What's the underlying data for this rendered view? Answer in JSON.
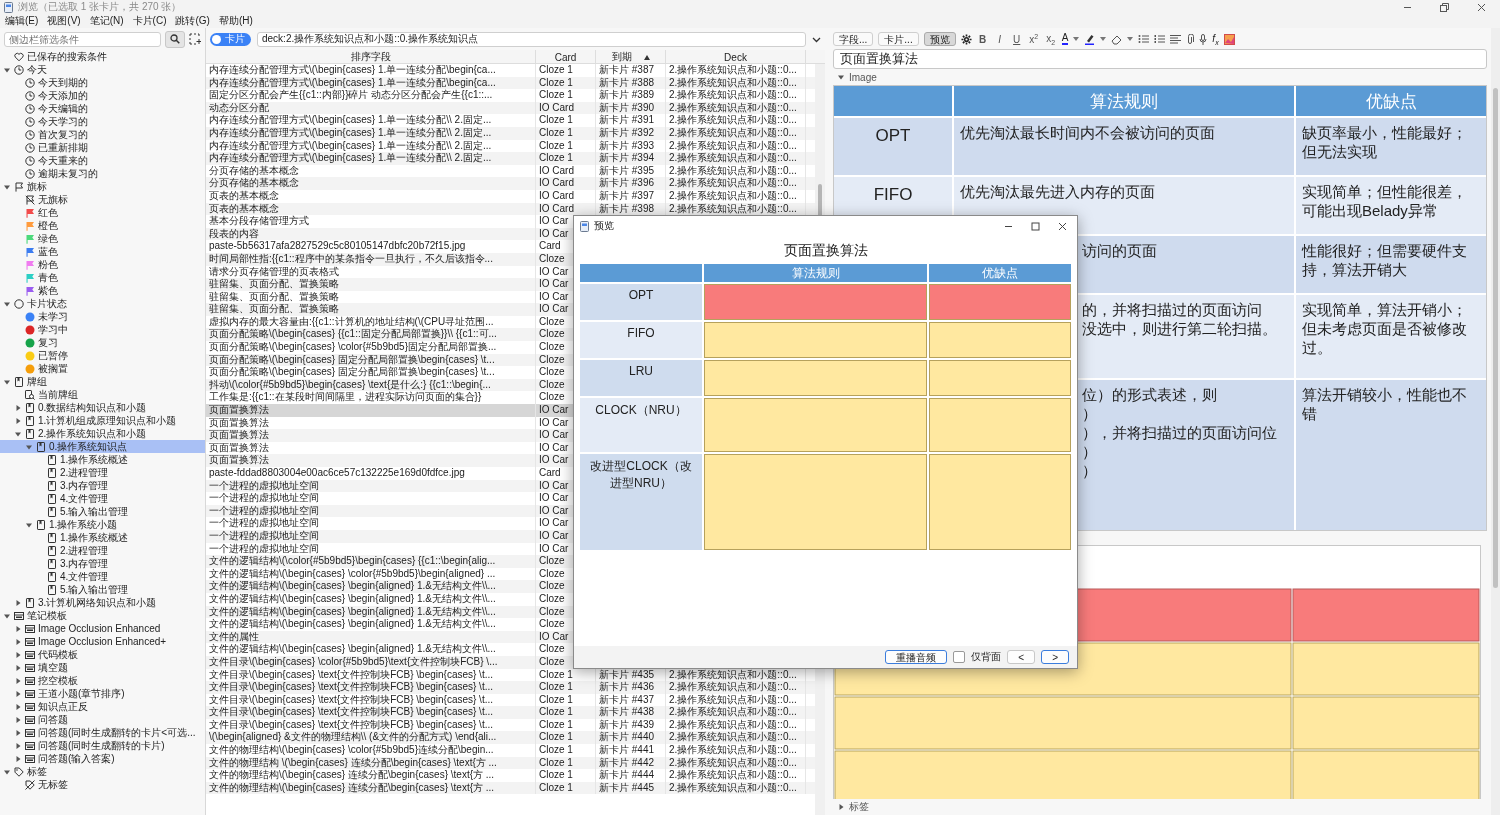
{
  "window": {
    "title": "浏览（已选取 1 张卡片，共 270 张）"
  },
  "menu": [
    "编辑(E)",
    "视图(V)",
    "笔记(N)",
    "卡片(C)",
    "跳转(G)",
    "帮助(H)"
  ],
  "sidebar": {
    "search": {
      "placeholder": "侧边栏筛选条件"
    },
    "tree": [
      {
        "label": "已保存的搜索条件",
        "kind": "saved",
        "selected": false
      },
      {
        "label": "今天",
        "kind": "clock",
        "expanded": true,
        "selected": false,
        "children": [
          {
            "label": "今天到期的",
            "kind": "clock",
            "selected": false
          },
          {
            "label": "今天添加的",
            "kind": "clock",
            "selected": false
          },
          {
            "label": "今天编辑的",
            "kind": "clock",
            "selected": false
          },
          {
            "label": "今天学习的",
            "kind": "clock",
            "selected": false
          },
          {
            "label": "首次复习的",
            "kind": "clock",
            "selected": false
          },
          {
            "label": "已重新排期",
            "kind": "clock",
            "selected": false
          },
          {
            "label": "今天重来的",
            "kind": "clock",
            "selected": false
          },
          {
            "label": "逾期未复习的",
            "kind": "clock",
            "selected": false
          }
        ]
      },
      {
        "label": "旗标",
        "kind": "flag",
        "expanded": true,
        "selected": false,
        "children": [
          {
            "label": "无旗标",
            "kind": "flag-off",
            "selected": false
          },
          {
            "label": "红色",
            "kind": "colored-flag",
            "color": "#f24b4b",
            "selected": false
          },
          {
            "label": "橙色",
            "kind": "colored-flag",
            "color": "#ff9b3d",
            "selected": false
          },
          {
            "label": "绿色",
            "kind": "colored-flag",
            "color": "#4cd97b",
            "selected": false
          },
          {
            "label": "蓝色",
            "kind": "colored-flag",
            "color": "#3b7cf0",
            "selected": false
          },
          {
            "label": "粉色",
            "kind": "colored-flag",
            "color": "#f07cf0",
            "selected": false
          },
          {
            "label": "青色",
            "kind": "colored-flag",
            "color": "#2ccfc4",
            "selected": false
          },
          {
            "label": "紫色",
            "kind": "colored-flag",
            "color": "#9a5cf0",
            "selected": false
          }
        ]
      },
      {
        "label": "卡片状态",
        "kind": "status",
        "expanded": true,
        "selected": false,
        "children": [
          {
            "label": "未学习",
            "kind": "status-dot",
            "color": "#3b82f6",
            "selected": false
          },
          {
            "label": "学习中",
            "kind": "status-dot",
            "color": "#dc2626",
            "selected": false
          },
          {
            "label": "复习",
            "kind": "status-dot",
            "color": "#16a34a",
            "selected": false
          },
          {
            "label": "已暂停",
            "kind": "status-dot",
            "color": "#facc15",
            "selected": false
          },
          {
            "label": "被搁置",
            "kind": "status-dot",
            "color": "#f59e0b",
            "selected": false
          }
        ]
      },
      {
        "label": "牌组",
        "kind": "deck",
        "expanded": true,
        "selected": false,
        "children": [
          {
            "label": "当前牌组",
            "kind": "current-deck",
            "selected": false
          },
          {
            "label": "0.数据结构知识点和小题",
            "kind": "deck",
            "expanded": false,
            "selected": false
          },
          {
            "label": "1.计算机组成原理知识点和小题",
            "kind": "deck",
            "expanded": false,
            "selected": false
          },
          {
            "label": "2.操作系统知识点和小题",
            "kind": "deck",
            "expanded": true,
            "selected": false,
            "children": [
              {
                "label": "0.操作系统知识点",
                "kind": "deck",
                "expanded": true,
                "selected": true,
                "children": [
                  {
                    "label": "1.操作系统概述",
                    "kind": "deck",
                    "selected": false
                  },
                  {
                    "label": "2.进程管理",
                    "kind": "deck",
                    "selected": false
                  },
                  {
                    "label": "3.内存管理",
                    "kind": "deck",
                    "selected": false
                  },
                  {
                    "label": "4.文件管理",
                    "kind": "deck",
                    "selected": false
                  },
                  {
                    "label": "5.输入输出管理",
                    "kind": "deck",
                    "selected": false
                  }
                ]
              },
              {
                "label": "1.操作系统小题",
                "kind": "deck",
                "expanded": true,
                "selected": false,
                "children": [
                  {
                    "label": "1.操作系统概述",
                    "kind": "deck",
                    "selected": false
                  },
                  {
                    "label": "2.进程管理",
                    "kind": "deck",
                    "selected": false
                  },
                  {
                    "label": "3.内存管理",
                    "kind": "deck",
                    "selected": false
                  },
                  {
                    "label": "4.文件管理",
                    "kind": "deck",
                    "selected": false
                  },
                  {
                    "label": "5.输入输出管理",
                    "kind": "deck",
                    "selected": false
                  }
                ]
              }
            ]
          },
          {
            "label": "3.计算机网络知识点和小题",
            "kind": "deck",
            "expanded": false,
            "selected": false
          }
        ]
      },
      {
        "label": "笔记模板",
        "kind": "notetype",
        "expanded": true,
        "selected": false,
        "children": [
          {
            "label": "Image Occlusion Enhanced",
            "kind": "notetype",
            "expanded": false,
            "selected": false
          },
          {
            "label": "Image Occlusion Enhanced+",
            "kind": "notetype",
            "expanded": false,
            "selected": false
          },
          {
            "label": "代码模板",
            "kind": "notetype",
            "expanded": false,
            "selected": false
          },
          {
            "label": "填空题",
            "kind": "notetype",
            "expanded": false,
            "selected": false
          },
          {
            "label": "挖空模板",
            "kind": "notetype",
            "expanded": false,
            "selected": false
          },
          {
            "label": "王道小题(章节排序)",
            "kind": "notetype",
            "expanded": false,
            "selected": false
          },
          {
            "label": "知识点正反",
            "kind": "notetype",
            "expanded": false,
            "selected": false
          },
          {
            "label": "问答题",
            "kind": "notetype",
            "expanded": false,
            "selected": false
          },
          {
            "label": "问答题(同时生成翻转的卡片<可选...",
            "kind": "notetype",
            "expanded": false,
            "selected": false
          },
          {
            "label": "问答题(同时生成翻转的卡片)",
            "kind": "notetype",
            "expanded": false,
            "selected": false
          },
          {
            "label": "问答题(输入答案)",
            "kind": "notetype",
            "expanded": false,
            "selected": false
          }
        ]
      },
      {
        "label": "标签",
        "kind": "tag",
        "expanded": true,
        "selected": false,
        "children": [
          {
            "label": "无标签",
            "kind": "tag-off",
            "selected": false
          }
        ]
      }
    ]
  },
  "table": {
    "toggle": {
      "label": "卡片",
      "on": true
    },
    "search": {
      "value": "deck:2.操作系统知识点和小题::0.操作系统知识点"
    },
    "columns": [
      {
        "label": "排序字段",
        "sorted": false
      },
      {
        "label": "Card",
        "sorted": false
      },
      {
        "label": "到期",
        "sorted": true
      },
      {
        "label": "Deck",
        "sorted": false
      }
    ],
    "rows": [
      {
        "sort_field": "内存连续分配管理方式\\(\\begin{cases} 1.单一连续分配\\begin{ca...",
        "card": "Cloze 1",
        "due": "新卡片 #387",
        "deck": "2.操作系统知识点和小题::0...",
        "selected": false
      },
      {
        "sort_field": "内存连续分配管理方式\\(\\begin{cases} 1.单一连续分配\\begin{ca...",
        "card": "Cloze 1",
        "due": "新卡片 #388",
        "deck": "2.操作系统知识点和小题::0...",
        "selected": false
      },
      {
        "sort_field": "固定分区分配会产生{{c1::内部}}碎片 动态分区分配会产生{{c1::...",
        "card": "Cloze 1",
        "due": "新卡片 #389",
        "deck": "2.操作系统知识点和小题::0...",
        "selected": false
      },
      {
        "sort_field": "动态分区分配",
        "card": "IO Card",
        "due": "新卡片 #390",
        "deck": "2.操作系统知识点和小题::0...",
        "selected": false
      },
      {
        "sort_field": "内存连续分配管理方式\\(\\begin{cases} 1.单一连续分配\\\\ 2.固定...",
        "card": "Cloze 1",
        "due": "新卡片 #391",
        "deck": "2.操作系统知识点和小题::0...",
        "selected": false
      },
      {
        "sort_field": "内存连续分配管理方式\\(\\begin{cases} 1.单一连续分配\\\\ 2.固定...",
        "card": "Cloze 1",
        "due": "新卡片 #392",
        "deck": "2.操作系统知识点和小题::0...",
        "selected": false
      },
      {
        "sort_field": "内存连续分配管理方式\\(\\begin{cases} 1.单一连续分配\\\\ 2.固定...",
        "card": "Cloze 1",
        "due": "新卡片 #393",
        "deck": "2.操作系统知识点和小题::0...",
        "selected": false
      },
      {
        "sort_field": "内存连续分配管理方式\\(\\begin{cases} 1.单一连续分配\\\\ 2.固定...",
        "card": "Cloze 1",
        "due": "新卡片 #394",
        "deck": "2.操作系统知识点和小题::0...",
        "selected": false
      },
      {
        "sort_field": "分页存储的基本概念",
        "card": "IO Card",
        "due": "新卡片 #395",
        "deck": "2.操作系统知识点和小题::0...",
        "selected": false
      },
      {
        "sort_field": "分页存储的基本概念",
        "card": "IO Card",
        "due": "新卡片 #396",
        "deck": "2.操作系统知识点和小题::0...",
        "selected": false
      },
      {
        "sort_field": "页表的基本概念",
        "card": "IO Card",
        "due": "新卡片 #397",
        "deck": "2.操作系统知识点和小题::0...",
        "selected": false
      },
      {
        "sort_field": "页表的基本概念",
        "card": "IO Card",
        "due": "新卡片 #398",
        "deck": "2.操作系统知识点和小题::0...",
        "selected": false
      },
      {
        "sort_field": "基本分段存储管理方式",
        "card": "IO Car",
        "selected": false
      },
      {
        "sort_field": "段表的内容",
        "card": "IO Car",
        "selected": false
      },
      {
        "sort_field": "paste-5b56317afa2827529c5c80105147dbfc20b72f15.jpg",
        "card": "Card",
        "selected": false
      },
      {
        "sort_field": "时间局部性指:{{c1::程序中的某条指令一旦执行，不久后该指令...",
        "card": "Cloze",
        "selected": false
      },
      {
        "sort_field": "请求分页存储管理的页表格式",
        "card": "IO Car",
        "selected": false
      },
      {
        "sort_field": "驻留集、页面分配、置换策略",
        "card": "IO Car",
        "selected": false
      },
      {
        "sort_field": "驻留集、页面分配、置换策略",
        "card": "IO Car",
        "selected": false
      },
      {
        "sort_field": "驻留集、页面分配、置换策略",
        "card": "IO Car",
        "selected": false
      },
      {
        "sort_field": "虚拟内存的最大容量由:{{c1::计算机的地址结构(\\(CPU寻址范围...",
        "card": "Cloze",
        "selected": false
      },
      {
        "sort_field": "页面分配策略\\(\\begin{cases} {{c1::固定分配局部置换}}\\\\ {{c1::可...",
        "card": "Cloze",
        "selected": false
      },
      {
        "sort_field": "页面分配策略\\(\\begin{cases} \\color{#5b9bd5}固定分配局部置换...",
        "card": "Cloze",
        "selected": false
      },
      {
        "sort_field": "页面分配策略\\(\\begin{cases} 固定分配局部置换\\begin{cases} \\t...",
        "card": "Cloze",
        "selected": false
      },
      {
        "sort_field": "页面分配策略\\(\\begin{cases} 固定分配局部置换\\begin{cases} \\t...",
        "card": "Cloze",
        "selected": false
      },
      {
        "sort_field": "抖动\\(\\color{#5b9bd5}\\begin{cases} \\text{是什么:} {{c1::\\begin{...",
        "card": "Cloze",
        "selected": false
      },
      {
        "sort_field": "工作集是:{{c1::在某段时间间隔里，进程实际访问页面的集合}}",
        "card": "Cloze",
        "selected": false
      },
      {
        "sort_field": "页面置换算法",
        "card": "IO Car",
        "selected": true
      },
      {
        "sort_field": "页面置换算法",
        "card": "IO Car",
        "selected": false
      },
      {
        "sort_field": "页面置换算法",
        "card": "IO Car",
        "selected": false
      },
      {
        "sort_field": "页面置换算法",
        "card": "IO Car",
        "selected": false
      },
      {
        "sort_field": "页面置换算法",
        "card": "IO Car",
        "selected": false
      },
      {
        "sort_field": "paste-fddad8803004e00ac6ce57c132225e169d0fdfce.jpg",
        "card": "Card",
        "selected": false
      },
      {
        "sort_field": "一个进程的虚拟地址空间",
        "card": "IO Car",
        "selected": false
      },
      {
        "sort_field": "一个进程的虚拟地址空间",
        "card": "IO Car",
        "selected": false
      },
      {
        "sort_field": "一个进程的虚拟地址空间",
        "card": "IO Car",
        "selected": false
      },
      {
        "sort_field": "一个进程的虚拟地址空间",
        "card": "IO Car",
        "selected": false
      },
      {
        "sort_field": "一个进程的虚拟地址空间",
        "card": "IO Car",
        "selected": false
      },
      {
        "sort_field": "一个进程的虚拟地址空间",
        "card": "IO Car",
        "selected": false
      },
      {
        "sort_field": "文件的逻辑结构\\(\\color{#5b9bd5}\\begin{cases} {{c1::\\begin{alig...",
        "card": "Cloze",
        "selected": false
      },
      {
        "sort_field": "文件的逻辑结构\\(\\begin{cases} \\color{#5b9bd5}\\begin{aligned} ...",
        "card": "Cloze",
        "selected": false
      },
      {
        "sort_field": "文件的逻辑结构\\(\\begin{cases} \\begin{aligned} 1.&无结构文件\\\\...",
        "card": "Cloze",
        "selected": false
      },
      {
        "sort_field": "文件的逻辑结构\\(\\begin{cases} \\begin{aligned} 1.&无结构文件\\\\...",
        "card": "Cloze",
        "selected": false
      },
      {
        "sort_field": "文件的逻辑结构\\(\\begin{cases} \\begin{aligned} 1.&无结构文件\\\\...",
        "card": "Cloze",
        "selected": false
      },
      {
        "sort_field": "文件的逻辑结构\\(\\begin{cases} \\begin{aligned} 1.&无结构文件\\\\...",
        "card": "Cloze",
        "selected": false
      },
      {
        "sort_field": "文件的属性",
        "card": "IO Car",
        "selected": false
      },
      {
        "sort_field": "文件的逻辑结构\\(\\begin{cases} \\begin{aligned} 1.&无结构文件\\\\...",
        "card": "Cloze",
        "selected": false
      },
      {
        "sort_field": "文件目录\\(\\begin{cases} \\color{#5b9bd5}\\text{文件控制块FCB} \\...",
        "card": "Cloze",
        "selected": false
      },
      {
        "sort_field": "文件目录\\(\\begin{cases} \\text{文件控制块FCB} \\begin{cases} \\t...",
        "card": "Cloze 1",
        "due": "新卡片 #435",
        "deck": "2.操作系统知识点和小题::0...",
        "selected": false
      },
      {
        "sort_field": "文件目录\\(\\begin{cases} \\text{文件控制块FCB} \\begin{cases} \\t...",
        "card": "Cloze 1",
        "due": "新卡片 #436",
        "deck": "2.操作系统知识点和小题::0...",
        "selected": false
      },
      {
        "sort_field": "文件目录\\(\\begin{cases} \\text{文件控制块FCB} \\begin{cases} \\t...",
        "card": "Cloze 1",
        "due": "新卡片 #437",
        "deck": "2.操作系统知识点和小题::0...",
        "selected": false
      },
      {
        "sort_field": "文件目录\\(\\begin{cases} \\text{文件控制块FCB} \\begin{cases} \\t...",
        "card": "Cloze 1",
        "due": "新卡片 #438",
        "deck": "2.操作系统知识点和小题::0...",
        "selected": false
      },
      {
        "sort_field": "文件目录\\(\\begin{cases} \\text{文件控制块FCB} \\begin{cases} \\t...",
        "card": "Cloze 1",
        "due": "新卡片 #439",
        "deck": "2.操作系统知识点和小题::0...",
        "selected": false
      },
      {
        "sort_field": "\\(\\begin{aligned} &文件的物理结构\\\\ (&文件的分配方式) \\end{ali...",
        "card": "Cloze 1",
        "due": "新卡片 #440",
        "deck": "2.操作系统知识点和小题::0...",
        "selected": false
      },
      {
        "sort_field": "文件的物理结构\\(\\begin{cases}  \\color{#5b9bd5}连续分配\\begin...",
        "card": "Cloze 1",
        "due": "新卡片 #441",
        "deck": "2.操作系统知识点和小题::0...",
        "selected": false
      },
      {
        "sort_field": "文件的物理结构 \\(\\begin{cases} 连续分配\\begin{cases} \\text{方 ...",
        "card": "Cloze 1",
        "due": "新卡片 #442",
        "deck": "2.操作系统知识点和小题::0...",
        "selected": false
      },
      {
        "sort_field": "文件的物理结构\\(\\begin{cases} 连续分配\\begin{cases} \\text{方 ...",
        "card": "Cloze 1",
        "due": "新卡片 #444",
        "deck": "2.操作系统知识点和小题::0...",
        "selected": false
      },
      {
        "sort_field": "文件的物理结构\\(\\begin{cases} 连续分配\\begin{cases} \\text{方 ...",
        "card": "Cloze 1",
        "due": "新卡片 #445",
        "deck": "2.操作系统知识点和小题::0...",
        "selected": false
      }
    ]
  },
  "editor": {
    "toolbar": {
      "buttons": [
        {
          "label": "字段...",
          "pressed": false
        },
        {
          "label": "卡片...",
          "pressed": false
        },
        {
          "label": "预览",
          "pressed": true
        }
      ],
      "format": [
        "B",
        "I",
        "U",
        "x$^{2}$",
        "x$_{2}$"
      ],
      "text_color": "A",
      "math": "f$_{x}$"
    },
    "field": {
      "value": "页面置换算法"
    },
    "image_field": {
      "label": "Image",
      "expanded": true
    },
    "image_table": {
      "headers": [
        "算法规则",
        "优缺点"
      ],
      "rows": [
        {
          "name": "OPT",
          "rule": "优先淘汰最长时间内不会被访问的页面",
          "pros": "缺页率最小，性能最好；但无法实现"
        },
        {
          "name": "FIFO",
          "rule": "优先淘汰最先进入内存的页面",
          "pros": "实现简单；但性能很差，可能出现Belady异常"
        },
        {
          "rule_parts": [
            "访问的页面"
          ],
          "pros": "性能很好；但需要硬件支持，算法开销大"
        },
        {
          "rule_parts": [
            "的，并将扫描过的页面访问",
            "没选中，则进行第二轮扫描。"
          ],
          "pros": "实现简单，算法开销小；但未考虑页面是否被修改过。"
        },
        {
          "rule_parts": [
            "位）的形式表述，则",
            "）",
            "），并将扫描过的页面访问位",
            "）",
            "）"
          ],
          "pros": "算法开销较小，性能也不错"
        }
      ]
    },
    "tags": {
      "label": "标签",
      "expanded": false
    }
  },
  "preview": {
    "title": "预览",
    "heading": "页面置换算法",
    "headers": [
      "算法规则",
      "优缺点"
    ],
    "rows": [
      {
        "name": "OPT",
        "color": "#f87b7b"
      },
      {
        "name": "FIFO",
        "color": "#ffe8a0"
      },
      {
        "name": "LRU",
        "color": "#ffe8a0"
      },
      {
        "name": "CLOCK（NRU）",
        "color": "#ffe8a0"
      },
      {
        "name": "改进型CLOCK（改进型NRU）",
        "color": "#ffe8a0"
      }
    ],
    "replay": "重播音频",
    "back_only": {
      "label": "仅背面",
      "checked": false
    },
    "prev": "<",
    "next": ">"
  }
}
